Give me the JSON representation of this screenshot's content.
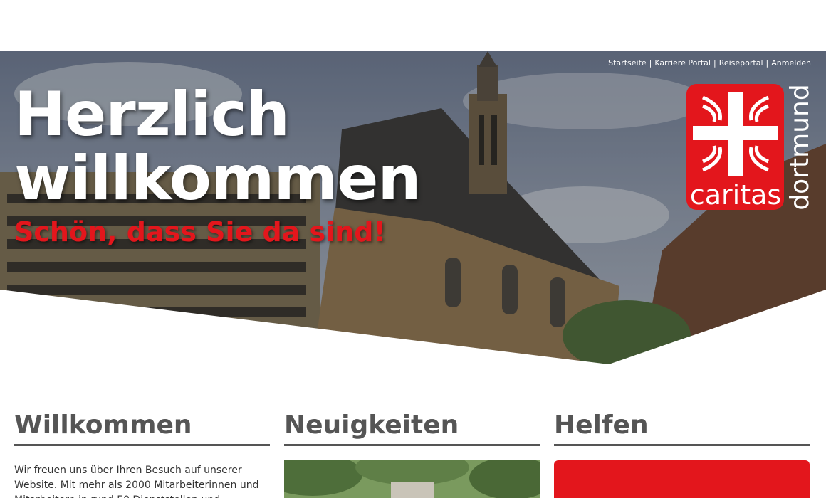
{
  "nav": {
    "links": [
      "Startseite",
      "Karriere Portal",
      "Reiseportal",
      "Anmelden"
    ],
    "separator": "|"
  },
  "hero": {
    "title_line1": "Herzlich",
    "title_line2": "willkommen",
    "subtitle": "Schön, dass Sie da sind!"
  },
  "logo": {
    "word": "caritas",
    "city": "dortmund"
  },
  "columns": {
    "welcome": {
      "title": "Willkommen",
      "text": "Wir freuen uns über Ihren Besuch auf unserer Website. Mit mehr als 2000 Mitarbeiterinnen und Mitarbeitern in rund 50 Dienststellen und"
    },
    "news": {
      "title": "Neuigkeiten"
    },
    "help": {
      "title": "Helfen"
    }
  },
  "colors": {
    "brand_red": "#e3161c",
    "heading_gray": "#555555"
  },
  "icons": [
    "caritas-cross-icon"
  ]
}
